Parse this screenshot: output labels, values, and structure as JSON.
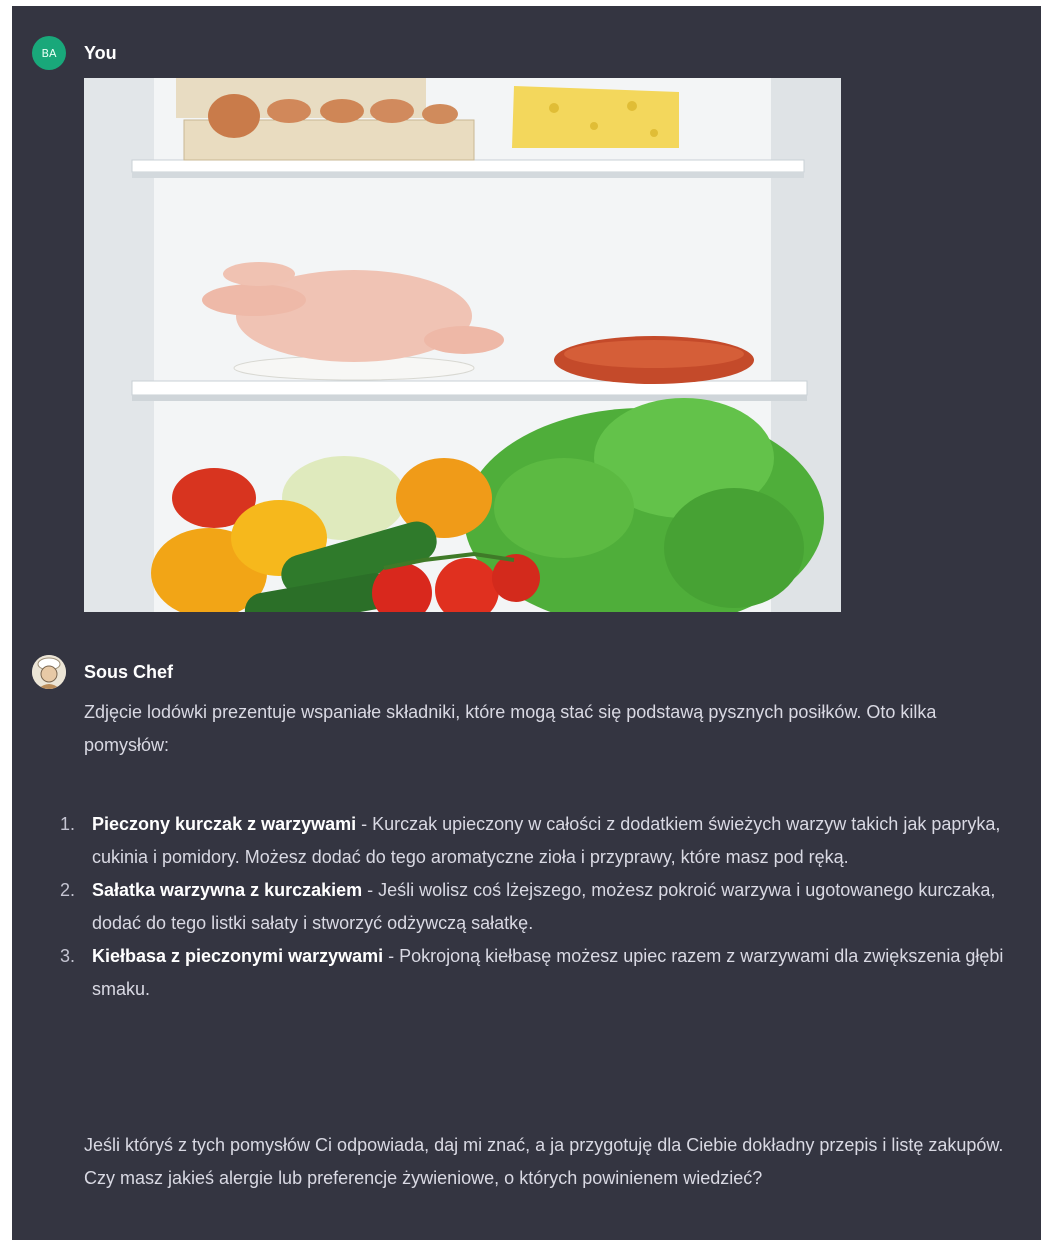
{
  "user_message": {
    "avatar_initials": "BA",
    "author": "You",
    "image": {
      "subject": "open refrigerator with eggs, cheese, whole chicken, sausage, peppers, cabbage, cucumbers, tomatoes and lettuce"
    }
  },
  "assistant_message": {
    "author": "Sous Chef",
    "intro": "Zdjęcie lodówki prezentuje wspaniałe składniki, które mogą stać się podstawą pysznych posiłków. Oto kilka pomysłów:",
    "ideas": [
      {
        "number": "1.",
        "title": "Pieczony kurczak z warzywami",
        "text": " - Kurczak upieczony w całości z dodatkiem świeżych warzyw takich jak papryka, cukinia i pomidory. Możesz dodać do tego aromatyczne zioła i przyprawy, które masz pod ręką."
      },
      {
        "number": "2.",
        "title": "Sałatka warzywna z kurczakiem",
        "text": " - Jeśli wolisz coś lżejszego, możesz pokroić warzywa i ugotowanego kurczaka, dodać do tego listki sałaty i stworzyć odżywczą sałatkę."
      },
      {
        "number": "3.",
        "title": "Kiełbasa z pieczonymi warzywami",
        "text": " - Pokrojoną kiełbasę możesz upiec razem z warzywami dla zwiększenia głębi smaku."
      }
    ],
    "closing": "Jeśli któryś z tych pomysłów Ci odpowiada, daj mi znać, a ja przygotuję dla Ciebie dokładny przepis i listę zakupów. Czy masz jakieś alergie lub preferencje żywieniowe, o których powinienem wiedzieć?"
  },
  "colors": {
    "background": "#343541",
    "user_avatar": "#19a87a",
    "text": "#d9d9e3"
  }
}
